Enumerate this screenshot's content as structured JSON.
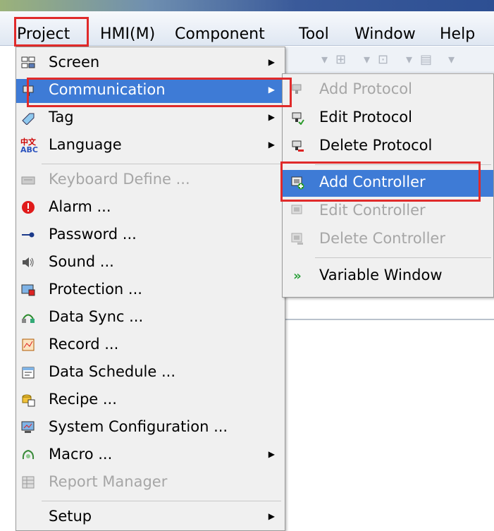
{
  "menubar": {
    "items": [
      "Project",
      "HMI(M)",
      "Component",
      "Tool",
      "Window",
      "Help"
    ]
  },
  "project_menu": {
    "items": [
      {
        "label": "Screen",
        "icon": "screen-icon",
        "submenu": true,
        "disabled": false
      },
      {
        "label": "Communication",
        "icon": "communication-icon",
        "submenu": true,
        "disabled": false,
        "highlighted": true
      },
      {
        "label": "Tag",
        "icon": "tag-icon",
        "submenu": true,
        "disabled": false
      },
      {
        "label": "Language",
        "icon": "language-icon",
        "submenu": true,
        "disabled": false
      },
      {
        "label": "Keyboard Define ...",
        "icon": "keyboard-icon",
        "submenu": false,
        "disabled": true
      },
      {
        "label": "Alarm ...",
        "icon": "alarm-icon",
        "submenu": false,
        "disabled": false
      },
      {
        "label": "Password ...",
        "icon": "key-icon",
        "submenu": false,
        "disabled": false
      },
      {
        "label": "Sound ...",
        "icon": "speaker-icon",
        "submenu": false,
        "disabled": false
      },
      {
        "label": "Protection ...",
        "icon": "protection-icon",
        "submenu": false,
        "disabled": false
      },
      {
        "label": "Data Sync ...",
        "icon": "data-sync-icon",
        "submenu": false,
        "disabled": false
      },
      {
        "label": "Record ...",
        "icon": "record-icon",
        "submenu": false,
        "disabled": false
      },
      {
        "label": "Data Schedule ...",
        "icon": "schedule-icon",
        "submenu": false,
        "disabled": false
      },
      {
        "label": "Recipe ...",
        "icon": "recipe-icon",
        "submenu": false,
        "disabled": false
      },
      {
        "label": "System Configuration ...",
        "icon": "system-config-icon",
        "submenu": false,
        "disabled": false
      },
      {
        "label": "Macro ...",
        "icon": "macro-icon",
        "submenu": true,
        "disabled": false
      },
      {
        "label": "Report Manager",
        "icon": "report-icon",
        "submenu": false,
        "disabled": true
      },
      {
        "label": "Setup",
        "icon": "",
        "submenu": true,
        "disabled": false
      }
    ]
  },
  "communication_submenu": {
    "items": [
      {
        "label": "Add Protocol",
        "icon": "add-protocol-icon",
        "disabled": true
      },
      {
        "label": "Edit Protocol",
        "icon": "edit-protocol-icon",
        "disabled": false
      },
      {
        "label": "Delete Protocol",
        "icon": "delete-protocol-icon",
        "disabled": false
      },
      {
        "label": "Add Controller",
        "icon": "add-controller-icon",
        "disabled": false,
        "highlighted": true
      },
      {
        "label": "Edit Controller",
        "icon": "edit-controller-icon",
        "disabled": true
      },
      {
        "label": "Delete Controller",
        "icon": "delete-controller-icon",
        "disabled": true
      },
      {
        "label": "Variable Window",
        "icon": "variable-window-icon",
        "disabled": false
      }
    ]
  },
  "colors": {
    "highlight": "#3e7bd6",
    "annotation_box": "#e02a2a",
    "disabled_text": "#a6a6a6"
  }
}
